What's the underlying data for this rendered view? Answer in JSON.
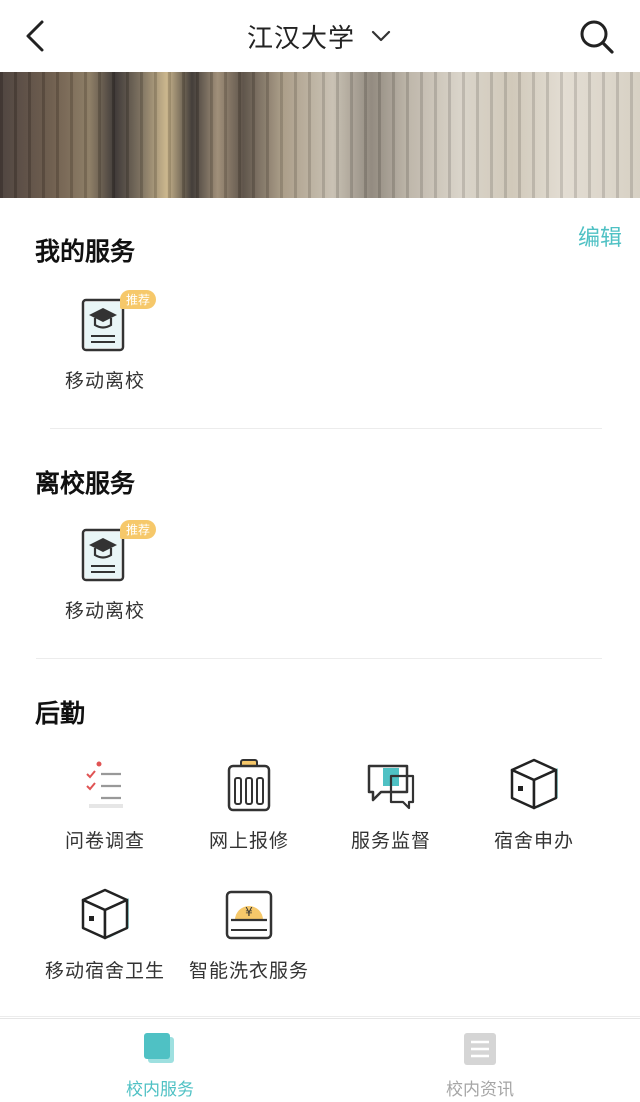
{
  "header": {
    "title": "江汉大学",
    "back_icon": "back-arrow-icon",
    "dropdown_icon": "chevron-down-icon",
    "search_icon": "search-icon"
  },
  "sections": {
    "my_services": {
      "title": "我的服务",
      "edit_label": "编辑",
      "items": [
        {
          "label": "移动离校",
          "badge": "推荐",
          "icon": "graduation-document-icon"
        }
      ]
    },
    "leave_services": {
      "title": "离校服务",
      "items": [
        {
          "label": "移动离校",
          "badge": "推荐",
          "icon": "graduation-document-icon"
        }
      ]
    },
    "logistics": {
      "title": "后勤",
      "items": [
        {
          "label": "问卷调查",
          "icon": "checklist-icon"
        },
        {
          "label": "网上报修",
          "icon": "clipboard-repair-icon"
        },
        {
          "label": "服务监督",
          "icon": "chat-bubble-icon"
        },
        {
          "label": "宿舍申办",
          "icon": "box-icon"
        },
        {
          "label": "移动宿舍卫生",
          "icon": "box-icon"
        },
        {
          "label": "智能洗衣服务",
          "icon": "laundry-yen-icon"
        }
      ]
    }
  },
  "tabbar": {
    "tabs": [
      {
        "label": "校内服务",
        "icon": "campus-service-icon",
        "active": true
      },
      {
        "label": "校内资讯",
        "icon": "news-document-icon",
        "active": false
      }
    ]
  },
  "colors": {
    "accent": "#4fc1c4",
    "badge": "#f6c86a",
    "inactive": "#a6a6a6"
  }
}
